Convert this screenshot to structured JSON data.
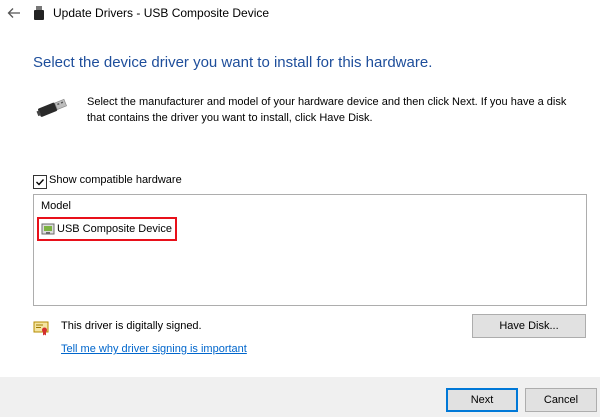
{
  "window": {
    "title": "Update Drivers - USB Composite Device"
  },
  "page": {
    "heading": "Select the device driver you want to install for this hardware.",
    "instruction": "Select the manufacturer and model of your hardware device and then click Next. If you have a disk that contains the driver you want to install, click Have Disk."
  },
  "compat": {
    "label": "Show compatible hardware",
    "checked": true
  },
  "model_list": {
    "header": "Model",
    "items": [
      {
        "label": "USB Composite Device",
        "selected": true
      }
    ]
  },
  "signing": {
    "status": "This driver is digitally signed.",
    "link": "Tell me why driver signing is important"
  },
  "buttons": {
    "have_disk": "Have Disk...",
    "next": "Next",
    "cancel": "Cancel"
  },
  "icons": {
    "back": "back-arrow-icon",
    "title": "usb-device-icon",
    "device": "usb-plug-icon",
    "model_item": "device-driver-icon",
    "signed": "certificate-icon"
  },
  "colors": {
    "heading": "#1e4e9b",
    "link": "#0066cc",
    "highlight_border": "#e8101a",
    "default_button_border": "#0078d7"
  }
}
